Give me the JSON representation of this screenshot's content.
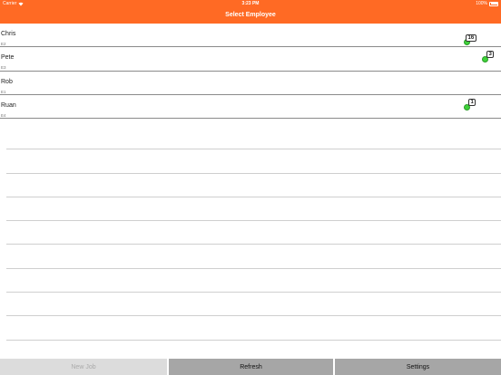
{
  "status_bar": {
    "carrier": "Carrier",
    "time": "3:23 PM",
    "battery": "100%"
  },
  "nav": {
    "title": "Select Employee"
  },
  "employees": [
    {
      "name": "Chris",
      "code": "E2",
      "badge": "16",
      "status_color": "#3fd13a"
    },
    {
      "name": "Pete",
      "code": "E3",
      "badge": "3",
      "status_color": "#3fd13a"
    },
    {
      "name": "Rob",
      "code": "E1",
      "badge": "",
      "status_color": ""
    },
    {
      "name": "Ruan",
      "code": "E4",
      "badge": "1",
      "status_color": "#3fd13a"
    }
  ],
  "toolbar": {
    "new_job": "New Job",
    "refresh": "Refresh",
    "settings": "Settings"
  },
  "colors": {
    "accent": "#ff6a24",
    "status_ok": "#3fd13a"
  }
}
